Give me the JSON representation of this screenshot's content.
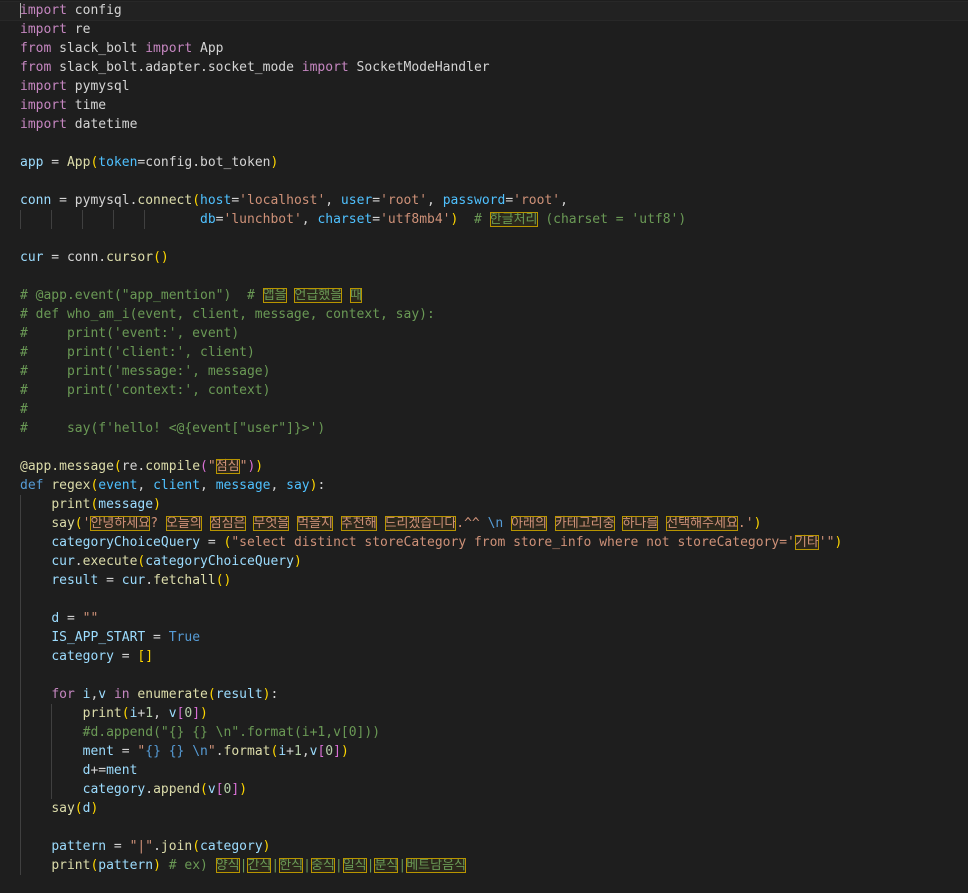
{
  "editor": {
    "lines": [
      [
        [
          "kw",
          "import"
        ],
        [
          "pl",
          " config"
        ]
      ],
      [
        [
          "kw",
          "import"
        ],
        [
          "pl",
          " re"
        ]
      ],
      [
        [
          "kw",
          "from"
        ],
        [
          "pl",
          " slack_bolt "
        ],
        [
          "kw",
          "import"
        ],
        [
          "pl",
          " App"
        ]
      ],
      [
        [
          "kw",
          "from"
        ],
        [
          "pl",
          " slack_bolt.adapter.socket_mode "
        ],
        [
          "kw",
          "import"
        ],
        [
          "pl",
          " SocketModeHandler"
        ]
      ],
      [
        [
          "kw",
          "import"
        ],
        [
          "pl",
          " pymysql"
        ]
      ],
      [
        [
          "kw",
          "import"
        ],
        [
          "pl",
          " time"
        ]
      ],
      [
        [
          "kw",
          "import"
        ],
        [
          "pl",
          " datetime"
        ]
      ],
      [],
      [
        [
          "var",
          "app"
        ],
        [
          "pl",
          " = "
        ],
        [
          "fn",
          "App"
        ],
        [
          "br1",
          "("
        ],
        [
          "par",
          "token"
        ],
        [
          "pl",
          "=config.bot_token"
        ],
        [
          "br1",
          ")"
        ]
      ],
      [],
      [
        [
          "var",
          "conn"
        ],
        [
          "pl",
          " = pymysql."
        ],
        [
          "fn",
          "connect"
        ],
        [
          "br1",
          "("
        ],
        [
          "par",
          "host"
        ],
        [
          "pl",
          "="
        ],
        [
          "str",
          "'localhost'"
        ],
        [
          "pl",
          ", "
        ],
        [
          "par",
          "user"
        ],
        [
          "pl",
          "="
        ],
        [
          "str",
          "'root'"
        ],
        [
          "pl",
          ", "
        ],
        [
          "par",
          "password"
        ],
        [
          "pl",
          "="
        ],
        [
          "str",
          "'root'"
        ],
        [
          "pl",
          ","
        ]
      ],
      [
        [
          "pl",
          "                       "
        ],
        [
          "par",
          "db"
        ],
        [
          "pl",
          "="
        ],
        [
          "str",
          "'lunchbot'"
        ],
        [
          "pl",
          ", "
        ],
        [
          "par",
          "charset"
        ],
        [
          "pl",
          "="
        ],
        [
          "str",
          "'utf8mb4'"
        ],
        [
          "br1",
          ")"
        ],
        [
          "pl",
          "  "
        ],
        [
          "cm",
          "# "
        ],
        [
          "cmh",
          "한글처리"
        ],
        [
          "cm",
          " (charset = 'utf8')"
        ]
      ],
      [],
      [
        [
          "var",
          "cur"
        ],
        [
          "pl",
          " = conn."
        ],
        [
          "fn",
          "cursor"
        ],
        [
          "br1",
          "()"
        ]
      ],
      [],
      [
        [
          "cm",
          "# @app.event(\"app_mention\")  # "
        ],
        [
          "cmh",
          "앱을"
        ],
        [
          "cm",
          " "
        ],
        [
          "cmh",
          "언급했을"
        ],
        [
          "cm",
          " "
        ],
        [
          "cmh",
          "때"
        ]
      ],
      [
        [
          "cm",
          "# def who_am_i(event, client, message, context, say):"
        ]
      ],
      [
        [
          "cm",
          "#     print('event:', event)"
        ]
      ],
      [
        [
          "cm",
          "#     print('client:', client)"
        ]
      ],
      [
        [
          "cm",
          "#     print('message:', message)"
        ]
      ],
      [
        [
          "cm",
          "#     print('context:', context)"
        ]
      ],
      [
        [
          "cm",
          "#"
        ]
      ],
      [
        [
          "cm",
          "#     say(f'hello! <@{event[\"user\"]}>')"
        ]
      ],
      [],
      [
        [
          "fn",
          "@app.message"
        ],
        [
          "br1",
          "("
        ],
        [
          "pl",
          "re."
        ],
        [
          "fn",
          "compile"
        ],
        [
          "br2",
          "("
        ],
        [
          "str",
          "\""
        ],
        [
          "strh",
          "점심"
        ],
        [
          "str",
          "\""
        ],
        [
          "br2",
          ")"
        ],
        [
          "br1",
          ")"
        ]
      ],
      [
        [
          "k2",
          "def"
        ],
        [
          "pl",
          " "
        ],
        [
          "fn",
          "regex"
        ],
        [
          "br1",
          "("
        ],
        [
          "par",
          "event"
        ],
        [
          "pl",
          ", "
        ],
        [
          "par",
          "client"
        ],
        [
          "pl",
          ", "
        ],
        [
          "par",
          "message"
        ],
        [
          "pl",
          ", "
        ],
        [
          "par",
          "say"
        ],
        [
          "br1",
          ")"
        ],
        [
          "pl",
          ":"
        ]
      ],
      [
        [
          "pl",
          "    "
        ],
        [
          "fn",
          "print"
        ],
        [
          "br1",
          "("
        ],
        [
          "var",
          "message"
        ],
        [
          "br1",
          ")"
        ]
      ],
      [
        [
          "pl",
          "    "
        ],
        [
          "fn",
          "say"
        ],
        [
          "br1",
          "("
        ],
        [
          "str",
          "'"
        ],
        [
          "strh",
          "안녕하세요"
        ],
        [
          "str",
          "? "
        ],
        [
          "strh",
          "오늘의"
        ],
        [
          "str",
          " "
        ],
        [
          "strh",
          "점심은"
        ],
        [
          "str",
          " "
        ],
        [
          "strh",
          "무엇을"
        ],
        [
          "str",
          " "
        ],
        [
          "strh",
          "먹을지"
        ],
        [
          "str",
          " "
        ],
        [
          "strh",
          "추천해"
        ],
        [
          "str",
          " "
        ],
        [
          "strh",
          "드리겠습니다"
        ],
        [
          "str",
          ".^^ "
        ],
        [
          "k2",
          "\\n"
        ],
        [
          "str",
          " "
        ],
        [
          "strh",
          "아래의"
        ],
        [
          "str",
          " "
        ],
        [
          "strh",
          "카테고리중"
        ],
        [
          "str",
          " "
        ],
        [
          "strh",
          "하나를"
        ],
        [
          "str",
          " "
        ],
        [
          "strh",
          "선택해주세요"
        ],
        [
          "str",
          ".'"
        ],
        [
          "br1",
          ")"
        ]
      ],
      [
        [
          "pl",
          "    "
        ],
        [
          "var",
          "categoryChoiceQuery"
        ],
        [
          "pl",
          " = "
        ],
        [
          "br1",
          "("
        ],
        [
          "str",
          "\"select distinct storeCategory from store_info where not storeCategory='"
        ],
        [
          "strh",
          "기타"
        ],
        [
          "str",
          "'\""
        ],
        [
          "br1",
          ")"
        ]
      ],
      [
        [
          "pl",
          "    "
        ],
        [
          "var",
          "cur"
        ],
        [
          "pl",
          "."
        ],
        [
          "fn",
          "execute"
        ],
        [
          "br1",
          "("
        ],
        [
          "var",
          "categoryChoiceQuery"
        ],
        [
          "br1",
          ")"
        ]
      ],
      [
        [
          "pl",
          "    "
        ],
        [
          "var",
          "result"
        ],
        [
          "pl",
          " = "
        ],
        [
          "var",
          "cur"
        ],
        [
          "pl",
          "."
        ],
        [
          "fn",
          "fetchall"
        ],
        [
          "br1",
          "()"
        ]
      ],
      [],
      [
        [
          "pl",
          "    "
        ],
        [
          "var",
          "d"
        ],
        [
          "pl",
          " = "
        ],
        [
          "str",
          "\"\""
        ]
      ],
      [
        [
          "pl",
          "    "
        ],
        [
          "var",
          "IS_APP_START"
        ],
        [
          "pl",
          " = "
        ],
        [
          "k2",
          "True"
        ]
      ],
      [
        [
          "pl",
          "    "
        ],
        [
          "var",
          "category"
        ],
        [
          "pl",
          " = "
        ],
        [
          "br1",
          "[]"
        ]
      ],
      [],
      [
        [
          "pl",
          "    "
        ],
        [
          "kw",
          "for"
        ],
        [
          "pl",
          " "
        ],
        [
          "var",
          "i"
        ],
        [
          "pl",
          ","
        ],
        [
          "var",
          "v"
        ],
        [
          "pl",
          " "
        ],
        [
          "kw",
          "in"
        ],
        [
          "pl",
          " "
        ],
        [
          "fn",
          "enumerate"
        ],
        [
          "br1",
          "("
        ],
        [
          "var",
          "result"
        ],
        [
          "br1",
          ")"
        ],
        [
          "pl",
          ":"
        ]
      ],
      [
        [
          "pl",
          "        "
        ],
        [
          "fn",
          "print"
        ],
        [
          "br1",
          "("
        ],
        [
          "var",
          "i"
        ],
        [
          "pl",
          "+"
        ],
        [
          "num",
          "1"
        ],
        [
          "pl",
          ", "
        ],
        [
          "var",
          "v"
        ],
        [
          "br2",
          "["
        ],
        [
          "num",
          "0"
        ],
        [
          "br2",
          "]"
        ],
        [
          "br1",
          ")"
        ]
      ],
      [
        [
          "pl",
          "        "
        ],
        [
          "cm",
          "#d.append(\"{} {} \\n\".format(i+1,v[0]))"
        ]
      ],
      [
        [
          "pl",
          "        "
        ],
        [
          "var",
          "ment"
        ],
        [
          "pl",
          " = "
        ],
        [
          "str",
          "\""
        ],
        [
          "k2",
          "{}"
        ],
        [
          "str",
          " "
        ],
        [
          "k2",
          "{}"
        ],
        [
          "str",
          " "
        ],
        [
          "k2",
          "\\n"
        ],
        [
          "str",
          "\""
        ],
        [
          "pl",
          "."
        ],
        [
          "fn",
          "format"
        ],
        [
          "br1",
          "("
        ],
        [
          "var",
          "i"
        ],
        [
          "pl",
          "+"
        ],
        [
          "num",
          "1"
        ],
        [
          "pl",
          ","
        ],
        [
          "var",
          "v"
        ],
        [
          "br2",
          "["
        ],
        [
          "num",
          "0"
        ],
        [
          "br2",
          "]"
        ],
        [
          "br1",
          ")"
        ]
      ],
      [
        [
          "pl",
          "        "
        ],
        [
          "var",
          "d"
        ],
        [
          "pl",
          "+="
        ],
        [
          "var",
          "ment"
        ]
      ],
      [
        [
          "pl",
          "        "
        ],
        [
          "var",
          "category"
        ],
        [
          "pl",
          "."
        ],
        [
          "fn",
          "append"
        ],
        [
          "br1",
          "("
        ],
        [
          "var",
          "v"
        ],
        [
          "br2",
          "["
        ],
        [
          "num",
          "0"
        ],
        [
          "br2",
          "]"
        ],
        [
          "br1",
          ")"
        ]
      ],
      [
        [
          "pl",
          "    "
        ],
        [
          "fn",
          "say"
        ],
        [
          "br1",
          "("
        ],
        [
          "var",
          "d"
        ],
        [
          "br1",
          ")"
        ]
      ],
      [],
      [
        [
          "pl",
          "    "
        ],
        [
          "var",
          "pattern"
        ],
        [
          "pl",
          " = "
        ],
        [
          "str",
          "\"|\""
        ],
        [
          "pl",
          "."
        ],
        [
          "fn",
          "join"
        ],
        [
          "br1",
          "("
        ],
        [
          "var",
          "category"
        ],
        [
          "br1",
          ")"
        ]
      ],
      [
        [
          "pl",
          "    "
        ],
        [
          "fn",
          "print"
        ],
        [
          "br1",
          "("
        ],
        [
          "var",
          "pattern"
        ],
        [
          "br1",
          ")"
        ],
        [
          "pl",
          " "
        ],
        [
          "cm",
          "# ex) "
        ],
        [
          "cmh",
          "양식"
        ],
        [
          "cm",
          "|"
        ],
        [
          "cmh",
          "간식"
        ],
        [
          "cm",
          "|"
        ],
        [
          "cmh",
          "한식"
        ],
        [
          "cm",
          "|"
        ],
        [
          "cmh",
          "중식"
        ],
        [
          "cm",
          "|"
        ],
        [
          "cmh",
          "일식"
        ],
        [
          "cm",
          "|"
        ],
        [
          "cmh",
          "분식"
        ],
        [
          "cm",
          "|"
        ],
        [
          "cmh",
          "베트남음식"
        ]
      ]
    ]
  }
}
